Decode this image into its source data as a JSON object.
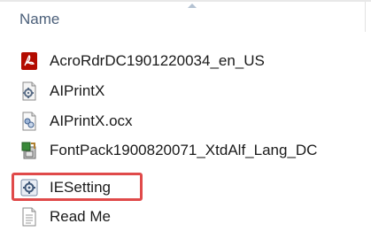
{
  "header": {
    "name_label": "Name"
  },
  "files": [
    {
      "name": "AcroRdrDC1901220034_en_US",
      "icon": "acrobat-installer-icon"
    },
    {
      "name": "AIPrintX",
      "icon": "settings-file-icon"
    },
    {
      "name": "AIPrintX.ocx",
      "icon": "activex-control-icon"
    },
    {
      "name": "FontPack1900820071_XtdAlf_Lang_DC",
      "icon": "installer-package-icon"
    },
    {
      "name": "IESetting",
      "icon": "registry-settings-icon",
      "highlighted": true
    },
    {
      "name": "Read Me",
      "icon": "text-document-icon"
    }
  ],
  "colors": {
    "highlight_border": "#e04a4a",
    "header_text": "#4c607a"
  }
}
